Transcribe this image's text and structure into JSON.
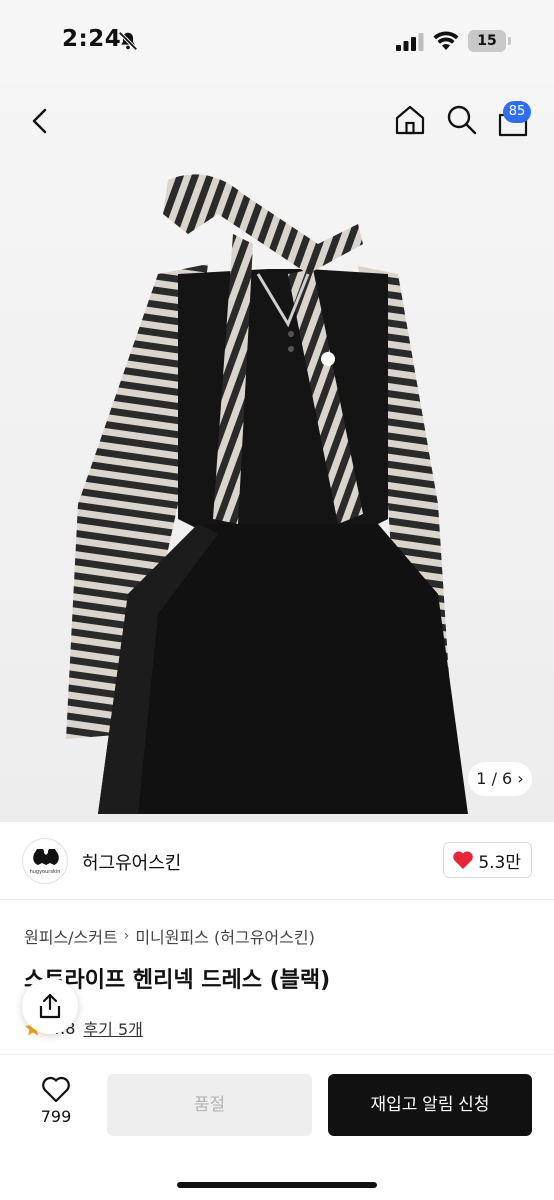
{
  "status_bar": {
    "time": "2:24",
    "battery": "15"
  },
  "nav": {
    "cart_count": "85"
  },
  "gallery": {
    "pager": "1 / 6 ›"
  },
  "brand": {
    "name": "허그유어스킨",
    "logo_text": "hugyourskin",
    "like_count": "5.3만"
  },
  "product": {
    "breadcrumb": [
      "원피스/스커트",
      "미니원피스 (허그유어스킨)"
    ],
    "breadcrumb_sep": "›",
    "title": "스트라이프 헨리넥 드레스 (블랙)",
    "rating": "4.8",
    "review_link": "후기 5개"
  },
  "actions": {
    "wish_count": "799",
    "soldout_label": "품절",
    "restock_label": "재입고 알림 신청"
  },
  "colors": {
    "accent_badge": "#2f6fed",
    "heart": "#e8263a",
    "primary_button": "#111111"
  }
}
